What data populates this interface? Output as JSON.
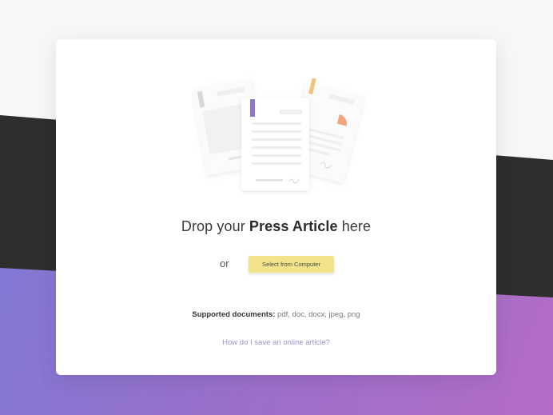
{
  "upload": {
    "headline_prefix": "Drop your ",
    "headline_bold": "Press Article",
    "headline_suffix": " here",
    "or_label": "or",
    "select_button_label": "Select from Computer",
    "supported_label": "Supported documents:",
    "supported_formats": " pdf, doc, docx, jpeg, png",
    "help_link": "How do I save an online article?"
  },
  "colors": {
    "button": "#f1e48a",
    "link": "#9a93cf",
    "dark_band": "#2e2e2e",
    "gradient_start": "#7a7bd6",
    "gradient_end": "#b46cc6",
    "bookmark_purple": "#8d79c9",
    "bookmark_orange": "#f0c27a",
    "pie_accent": "#f2a57a"
  },
  "icons": {
    "illustration": "documents-illustration"
  }
}
